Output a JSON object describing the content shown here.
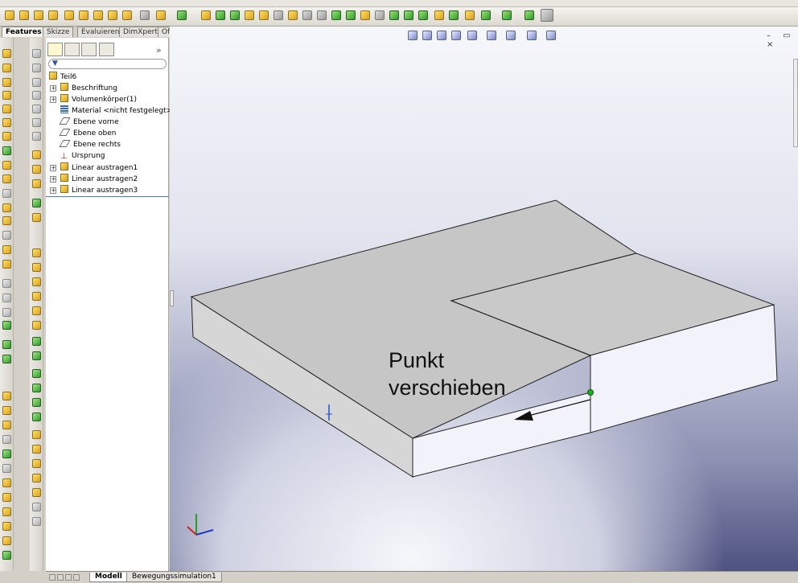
{
  "command_tabs": [
    {
      "label": "Features",
      "active": true
    },
    {
      "label": "Skizze",
      "active": false
    },
    {
      "label": "Evaluieren",
      "active": false
    },
    {
      "label": "DimXpert",
      "active": false
    },
    {
      "label": "Office Produkte",
      "active": false
    }
  ],
  "feature_tree": {
    "root": "Teil6",
    "items": [
      {
        "label": "Beschriftung",
        "expandable": true,
        "icon": "annotation-icon"
      },
      {
        "label": "Volumenkörper(1)",
        "expandable": true,
        "icon": "solid-bodies-icon"
      },
      {
        "label": "Material <nicht festgelegt>",
        "expandable": false,
        "icon": "material-icon"
      },
      {
        "label": "Ebene vorne",
        "expandable": false,
        "icon": "plane-icon"
      },
      {
        "label": "Ebene oben",
        "expandable": false,
        "icon": "plane-icon"
      },
      {
        "label": "Ebene rechts",
        "expandable": false,
        "icon": "plane-icon"
      },
      {
        "label": "Ursprung",
        "expandable": false,
        "icon": "origin-icon"
      },
      {
        "label": "Linear austragen1",
        "expandable": true,
        "icon": "extrude-icon"
      },
      {
        "label": "Linear austragen2",
        "expandable": true,
        "icon": "extrude-icon"
      },
      {
        "label": "Linear austragen3",
        "expandable": true,
        "icon": "extrude-icon"
      }
    ]
  },
  "fm_chevron": "»",
  "bottom_tabs": [
    {
      "label": "Modell",
      "active": true
    },
    {
      "label": "Bewegungssimulation1",
      "active": false
    }
  ],
  "callout": {
    "line1": "Punkt",
    "line2": "verschieben"
  },
  "window_controls": "– ▭ ×",
  "colors": {
    "viewport_top": "#f6f7fb",
    "viewport_bottom": "#4e5280",
    "face_top": "#c8c8c8",
    "face_front": "#f2f2fb",
    "point_marker": "#22aa22"
  }
}
